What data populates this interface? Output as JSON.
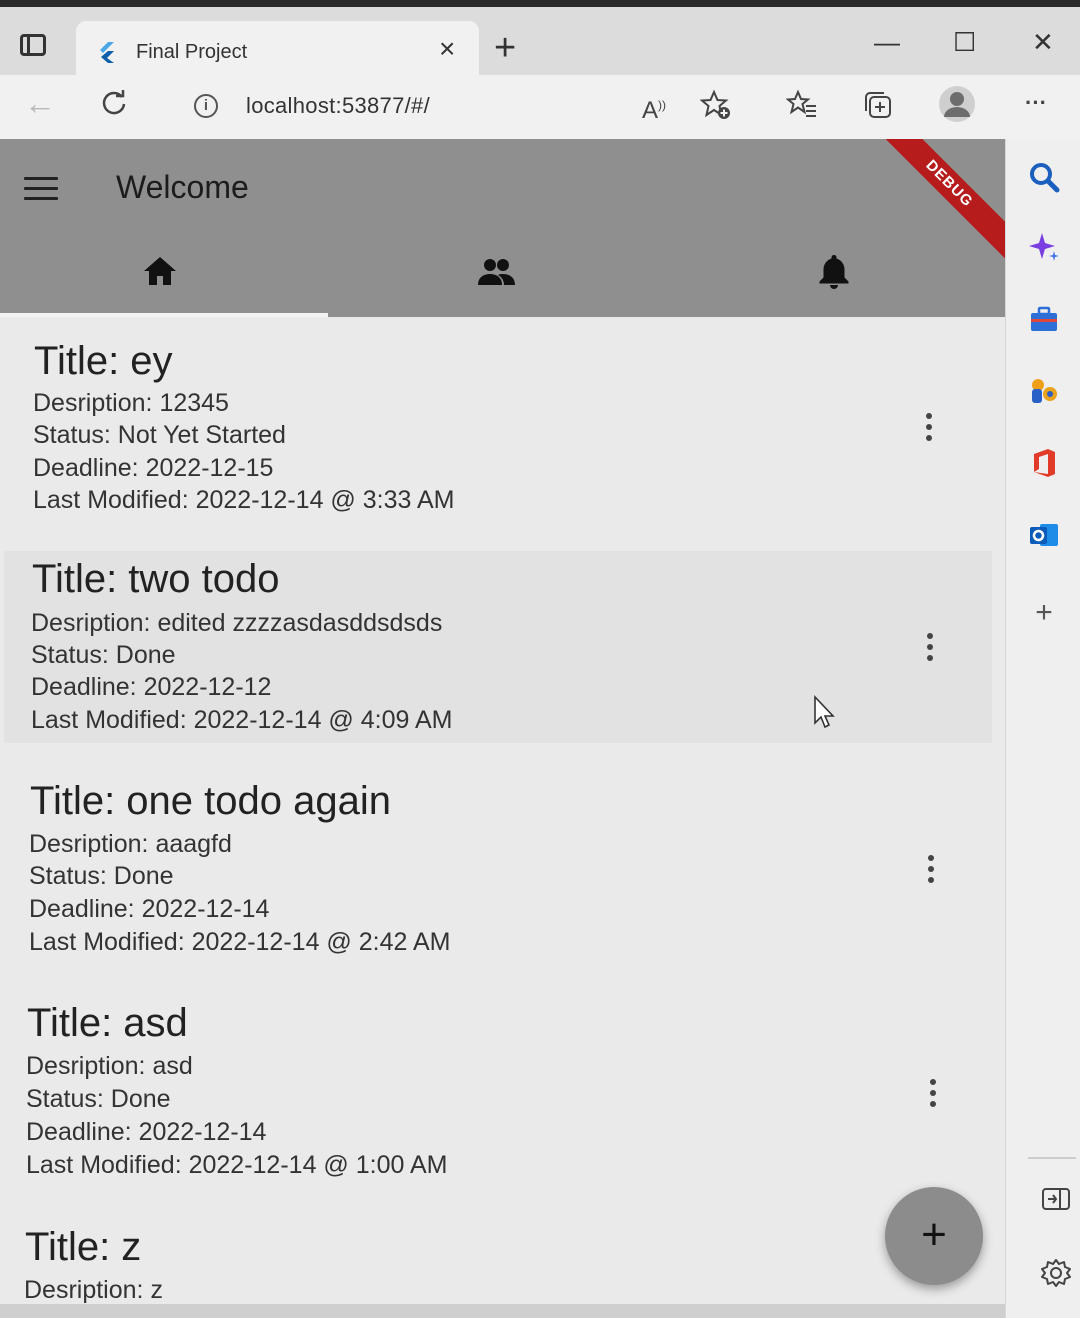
{
  "browser": {
    "tab": {
      "title": "Final Project"
    },
    "new_tab_symbol": "+",
    "window_controls": {
      "minimize": "—",
      "maximize": "☐",
      "close": "✕"
    },
    "address": {
      "url": "localhost:53877/#/"
    },
    "toolbar_icons": [
      "read-aloud-icon",
      "add-favorite-icon",
      "favorites-icon",
      "collections-icon",
      "profile-icon",
      "more-icon"
    ],
    "sidebar_icons": [
      "search-icon",
      "copilot-icon",
      "tools-icon",
      "games-icon",
      "office-icon",
      "outlook-icon",
      "add-icon",
      "hide-sidebar-icon",
      "settings-icon"
    ]
  },
  "app": {
    "appbar": {
      "title": "Welcome",
      "debug_label": "DEBUG"
    },
    "bottom_tabs": [
      {
        "icon": "home-icon",
        "selected": true
      },
      {
        "icon": "people-icon",
        "selected": false
      },
      {
        "icon": "bell-icon",
        "selected": false
      }
    ],
    "todos": [
      {
        "title": "Title: ey",
        "description": "Desription: 12345",
        "status": "Status: Not Yet Started",
        "deadline": "Deadline: 2022-12-15",
        "modified": "Last Modified: 2022-12-14 @ 3:33 AM"
      },
      {
        "title": "Title: two todo",
        "description": "Desription: edited zzzzasdasddsdsds",
        "status": "Status: Done",
        "deadline": "Deadline: 2022-12-12",
        "modified": "Last Modified: 2022-12-14 @ 4:09 AM"
      },
      {
        "title": "Title: one todo again",
        "description": "Desription: aaagfd",
        "status": "Status: Done",
        "deadline": "Deadline: 2022-12-14",
        "modified": "Last Modified: 2022-12-14 @ 2:42 AM"
      },
      {
        "title": "Title: asd",
        "description": "Desription: asd",
        "status": "Status: Done",
        "deadline": "Deadline: 2022-12-14",
        "modified": "Last Modified: 2022-12-14 @ 1:00 AM"
      },
      {
        "title": "Title: z",
        "description": "Desription: z"
      }
    ],
    "fab_symbol": "+"
  }
}
